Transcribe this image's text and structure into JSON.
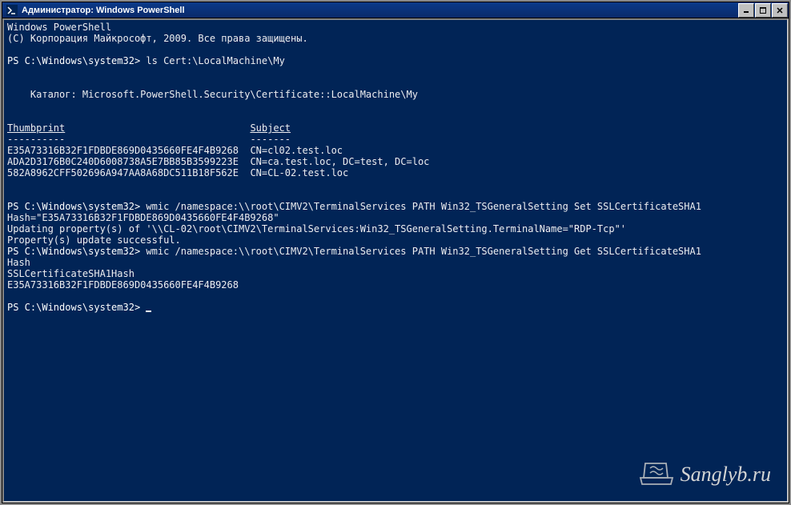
{
  "window": {
    "title": "Администратор: Windows PowerShell"
  },
  "terminal": {
    "header1": "Windows PowerShell",
    "header2": "(C) Корпорация Майкрософт, 2009. Все права защищены.",
    "prompt1": "PS C:\\Windows\\system32>",
    "cmd1": " ls Cert:\\LocalMachine\\My",
    "catalog": "    Каталог: Microsoft.PowerShell.Security\\Certificate::LocalMachine\\My",
    "col_thumbprint": "Thumbprint",
    "col_subject": "Subject",
    "col_sep1": "----------",
    "col_sep2": "-------",
    "certs": [
      {
        "thumbprint": "E35A73316B32F1FDBDE869D0435660FE4F4B9268",
        "subject": "CN=cl02.test.loc"
      },
      {
        "thumbprint": "ADA2D3176B0C240D6008738A5E7BB85B3599223E",
        "subject": "CN=ca.test.loc, DC=test, DC=loc"
      },
      {
        "thumbprint": "582A8962CFF502696A947AA8A68DC511B18F562E",
        "subject": "CN=CL-02.test.loc"
      }
    ],
    "prompt2": "PS C:\\Windows\\system32>",
    "cmd2a": " wmic /namespace:\\\\root\\CIMV2\\TerminalServices PATH Win32_TSGeneralSetting Set SSLCertificateSHA1",
    "cmd2b": "Hash=\"E35A73316B32F1FDBDE869D0435660FE4F4B9268\"",
    "out2a": "Updating property(s) of '\\\\CL-02\\root\\CIMV2\\TerminalServices:Win32_TSGeneralSetting.TerminalName=\"RDP-Tcp\"'",
    "out2b": "Property(s) update successful.",
    "prompt3": "PS C:\\Windows\\system32>",
    "cmd3a": " wmic /namespace:\\\\root\\CIMV2\\TerminalServices PATH Win32_TSGeneralSetting Get SSLCertificateSHA1",
    "cmd3b": "Hash",
    "out3a": "SSLCertificateSHA1Hash",
    "out3b": "E35A73316B32F1FDBDE869D0435660FE4F4B9268",
    "prompt4": "PS C:\\Windows\\system32> "
  },
  "watermark": "Sanglyb.ru"
}
